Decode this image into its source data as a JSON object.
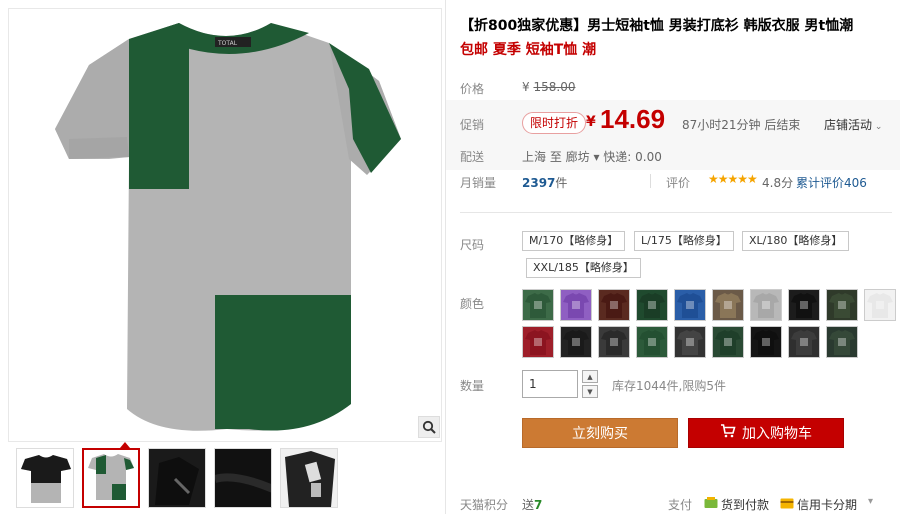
{
  "product": {
    "title": "【折800独家优惠】男士短袖t恤 男装打底衫 韩版衣服 男t恤潮",
    "subtitle": "包邮 夏季 短袖T恤 潮"
  },
  "price": {
    "label": "价格",
    "original_currency": "¥",
    "original": "158.00"
  },
  "promo": {
    "label": "促销",
    "badge": "限时打折",
    "currency": "¥",
    "price": "14.69",
    "countdown": "87小时21分钟 后结束",
    "shop_activity": "店铺活动"
  },
  "shipping": {
    "label": "配送",
    "text": "上海 至 廊坊 ▾ 快递: 0.00"
  },
  "sales": {
    "label": "月销量",
    "count": "2397",
    "unit": "件",
    "rating_label": "评价",
    "stars": "★★★★★",
    "score": "4.8分",
    "review_count": "累计评价406"
  },
  "sizes": {
    "label": "尺码",
    "options": [
      "M/170【略修身】",
      "L/175【略修身】",
      "XL/180【略修身】",
      "XXL/185【略修身】"
    ]
  },
  "colors": {
    "label": "颜色",
    "swatches": [
      {
        "bg": "#3d6b48",
        "body": "#2e5a3a"
      },
      {
        "bg": "#8f5fc2",
        "body": "#7a48b0"
      },
      {
        "bg": "#5a2a20",
        "body": "#4a1a14"
      },
      {
        "bg": "#1f4a2e",
        "body": "#1a3d26"
      },
      {
        "bg": "#2a5ea8",
        "body": "#1f4f96"
      },
      {
        "bg": "#6b5a48",
        "body": "#8a7658"
      },
      {
        "bg": "#b8b8b8",
        "body": "#a8a8a8"
      },
      {
        "bg": "#1c1c1c",
        "body": "#111111"
      },
      {
        "bg": "#2f3a2a",
        "body": "#3a4a34"
      },
      {
        "bg": "#f2f2f2",
        "body": "#e8e8e8"
      },
      {
        "bg": "#9e1f2a",
        "body": "#8c1420"
      },
      {
        "bg": "#222222",
        "body": "#1a1a1a"
      },
      {
        "bg": "#3a3a3a",
        "body": "#2a2a2a"
      },
      {
        "bg": "#2c5a3a",
        "body": "#245032"
      },
      {
        "bg": "#333333",
        "body": "#444444"
      },
      {
        "bg": "#2a4a34",
        "body": "#1f3f2a"
      },
      {
        "bg": "#151515",
        "body": "#0f0f0f"
      },
      {
        "bg": "#2f2f2f",
        "body": "#3c3c3c"
      },
      {
        "bg": "#2a3a30",
        "body": "#354838"
      }
    ]
  },
  "quantity": {
    "label": "数量",
    "value": "1",
    "stock": "库存1044件,限购5件"
  },
  "buttons": {
    "buy": "立刻购买",
    "cart": "加入购物车"
  },
  "points": {
    "label": "天猫积分",
    "prefix": "送",
    "value": "7"
  },
  "payment": {
    "label": "支付",
    "cod": "货到付款",
    "installment": "信用卡分期",
    "more": "▾"
  },
  "colors_theme": {
    "accent_red": "#c40000",
    "buy_orange": "#cc7a33",
    "link_blue": "#1e5a92",
    "tee_green": "#1f5a34",
    "tee_grey": "#b4b4b4"
  }
}
